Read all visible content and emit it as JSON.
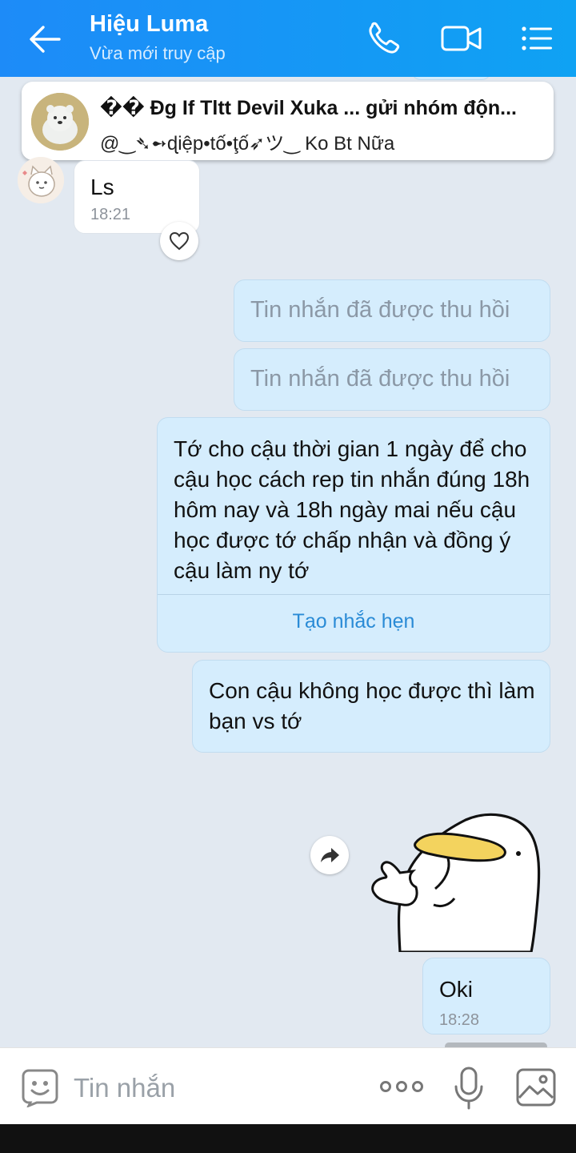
{
  "header": {
    "contact_name": "Hiệu Luma",
    "status": "Vừa mới truy cập",
    "icons": [
      "back-arrow-icon",
      "phone-icon",
      "video-call-icon",
      "menu-list-icon"
    ]
  },
  "pinned": {
    "title": "�� Đg If Tltt Devil Xuka ... gửi nhóm độn...",
    "subtitle": "@‿➴➻ɖiệp•tố•ţố➶ツ‿ Ko Bt Nữa"
  },
  "messages": [
    {
      "from": "friend",
      "text": "Ls",
      "time": "18:21",
      "reaction_icon": "heart-outline-icon"
    },
    {
      "from": "me",
      "recalled": true,
      "text": "Tin nhắn đã được thu hồi"
    },
    {
      "from": "me",
      "recalled": true,
      "text": "Tin nhắn đã được thu hồi"
    },
    {
      "from": "me",
      "text": "Tớ cho cậu thời gian 1 ngày để cho cậu học cách rep tin nhắn đúng 18h hôm nay và 18h ngày mai nếu cậu học được tớ chấp nhận và đồng ý cậu làm ny tớ",
      "action": "Tạo nhắc hẹn"
    },
    {
      "from": "me",
      "text": "Con cậu không học được thì làm bạn vs tớ"
    },
    {
      "from": "me",
      "sticker": "duck-thumbs-up-sticker",
      "side_action_icon": "share-forward-icon"
    },
    {
      "from": "me",
      "text": "Oki",
      "time": "18:28"
    }
  ],
  "composer": {
    "placeholder": "Tin nhắn",
    "icons": [
      "emoji-icon",
      "more-icon",
      "microphone-icon",
      "image-icon"
    ]
  },
  "colors": {
    "header_start": "#1d8bf8",
    "header_end": "#0fa2f3",
    "background": "#e2e9f1",
    "outgoing_bubble": "#d5edfd",
    "incoming_bubble": "#ffffff",
    "reminder_link": "#2a8bd6"
  }
}
